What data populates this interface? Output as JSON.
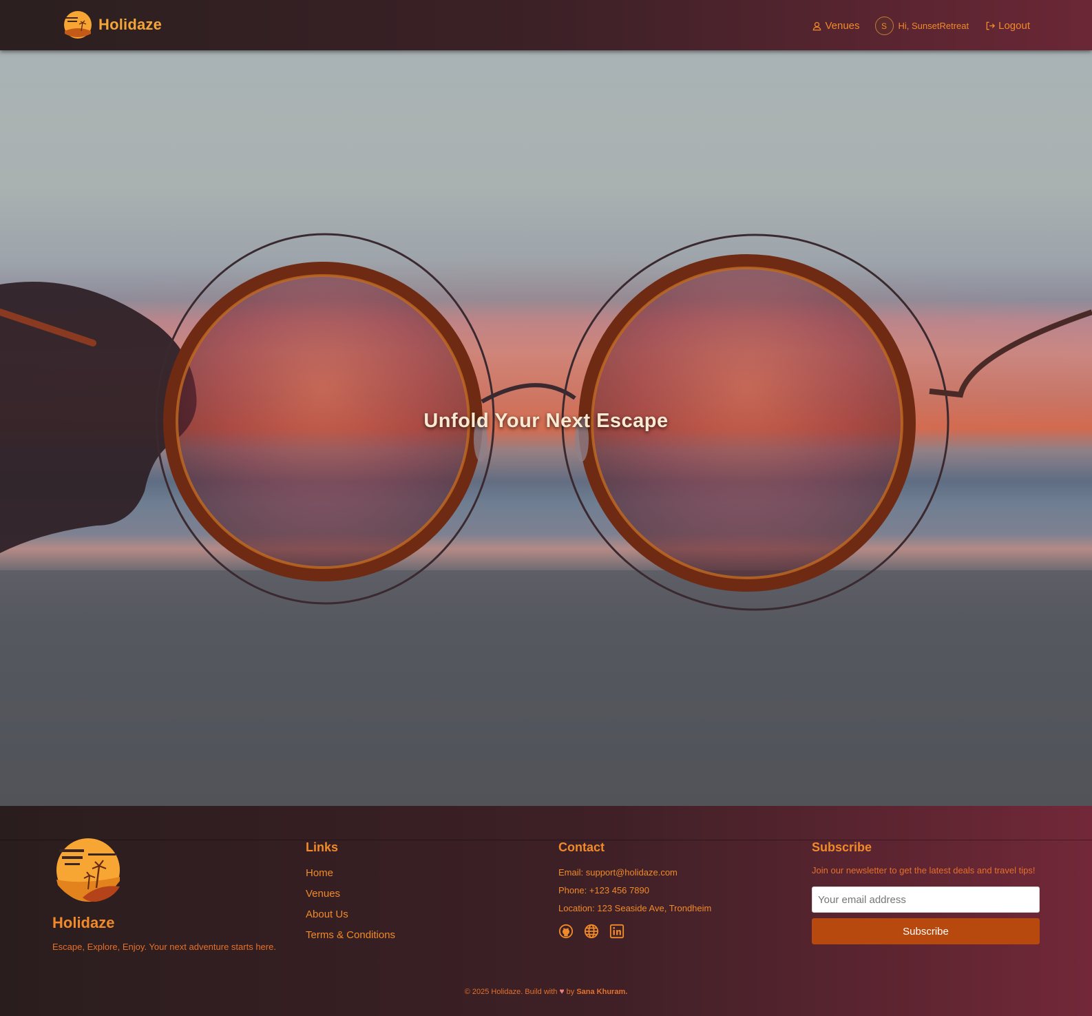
{
  "header": {
    "brand": "Holidaze",
    "nav": {
      "venues_label": "Venues",
      "user_initial": "S",
      "greeting": "Hi, SunsetRetreat",
      "logout_label": "Logout"
    }
  },
  "hero": {
    "title": "Unfold Your Next Escape"
  },
  "footer": {
    "brand": "Holidaze",
    "tagline": "Escape, Explore, Enjoy. Your next adventure starts here.",
    "links": {
      "title": "Links",
      "items": [
        "Home",
        "Venues",
        "About Us",
        "Terms & Conditions"
      ]
    },
    "contact": {
      "title": "Contact",
      "email": "Email: support@holidaze.com",
      "phone": "Phone: +123 456 7890",
      "location": "Location: 123 Seaside Ave, Trondheim",
      "socials": [
        "github-icon",
        "globe-icon",
        "linkedin-icon"
      ]
    },
    "subscribe": {
      "title": "Subscribe",
      "text": "Join our newsletter to get the latest deals and travel tips!",
      "placeholder": "Your email address",
      "button": "Subscribe"
    },
    "copyright": {
      "prefix": "© 2025 Holidaze. Build with",
      "by": "by",
      "author": "Sana Khuram."
    }
  },
  "colors": {
    "accent": "#f08a2a",
    "button": "#b8490e",
    "header_start": "#2b1f1f",
    "header_end": "#6b2736"
  }
}
